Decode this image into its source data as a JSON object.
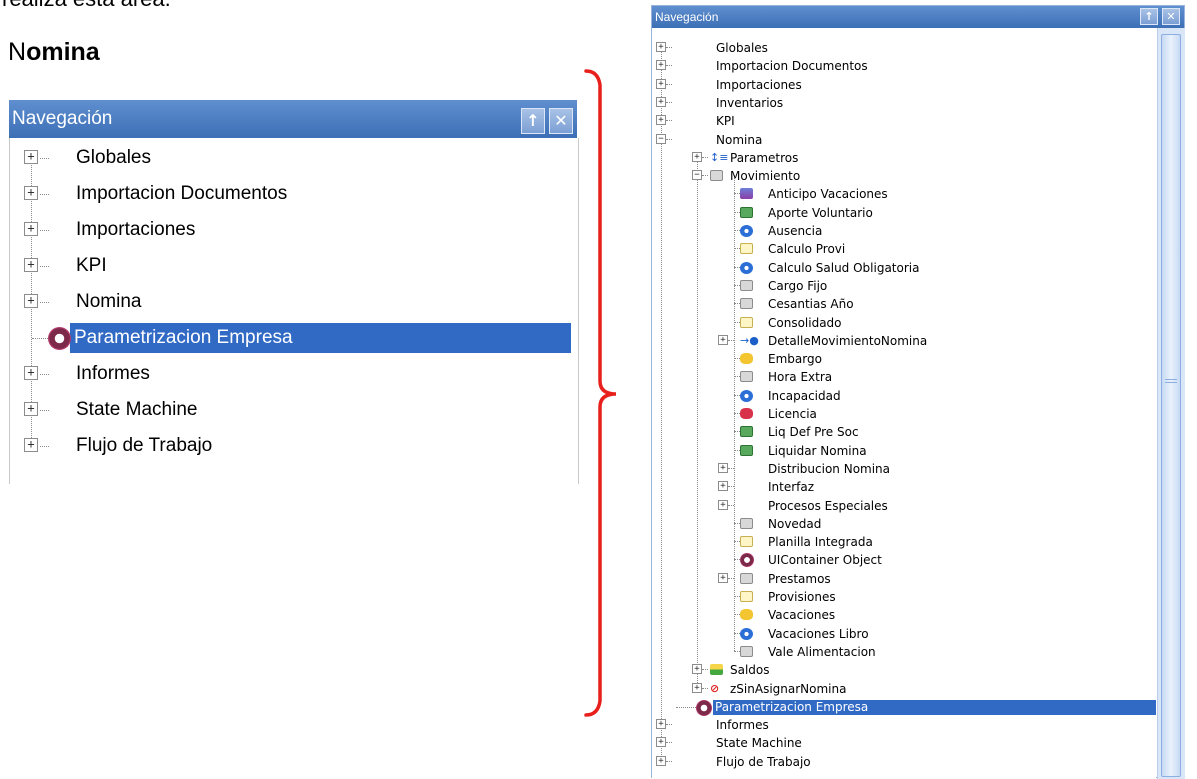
{
  "intro_text": "realiza esta área.",
  "section_title": {
    "prefix": "N",
    "rest": "omina"
  },
  "left_panel": {
    "title": "Navegación",
    "pin_glyph": "↑",
    "close_glyph": "✕",
    "items": [
      {
        "label": "Globales",
        "expandable": true
      },
      {
        "label": "Importacion Documentos",
        "expandable": true
      },
      {
        "label": "Importaciones",
        "expandable": true
      },
      {
        "label": "KPI",
        "expandable": true
      },
      {
        "label": "Nomina",
        "expandable": true
      },
      {
        "label": "Parametrizacion Empresa",
        "expandable": false,
        "selected": true,
        "icon": "gear-icon"
      },
      {
        "label": "Informes",
        "expandable": true
      },
      {
        "label": "State Machine",
        "expandable": true
      },
      {
        "label": "Flujo de Trabajo",
        "expandable": true
      }
    ]
  },
  "right_panel": {
    "title": "Navegación",
    "pin_glyph": "↑",
    "close_glyph": "✕",
    "items": [
      {
        "label": "Globales",
        "level": 0,
        "expander": "+"
      },
      {
        "label": "Importacion Documentos",
        "level": 0,
        "expander": "+"
      },
      {
        "label": "Importaciones",
        "level": 0,
        "expander": "+"
      },
      {
        "label": "Inventarios",
        "level": 0,
        "expander": "+"
      },
      {
        "label": "KPI",
        "level": 0,
        "expander": "+"
      },
      {
        "label": "Nomina",
        "level": 0,
        "expander": "-"
      },
      {
        "label": "Parametros",
        "level": 1,
        "expander": "+",
        "icon": "list-icon"
      },
      {
        "label": "Movimiento",
        "level": 1,
        "expander": "-",
        "icon": "gear-small-icon"
      },
      {
        "label": "Anticipo Vacaciones",
        "level": 2,
        "icon": "purple-form-icon"
      },
      {
        "label": "Aporte Voluntario",
        "level": 2,
        "icon": "money-icon"
      },
      {
        "label": "Ausencia",
        "level": 2,
        "icon": "blue-circle-icon"
      },
      {
        "label": "Calculo Provi",
        "level": 2,
        "icon": "document-icon"
      },
      {
        "label": "Calculo Salud Obligatoria",
        "level": 2,
        "icon": "blue-circle-icon"
      },
      {
        "label": "Cargo Fijo",
        "level": 2,
        "icon": "stamp-icon"
      },
      {
        "label": "Cesantias Año",
        "level": 2,
        "icon": "calculator-icon"
      },
      {
        "label": "Consolidado",
        "level": 2,
        "icon": "document-icon"
      },
      {
        "label": "DetalleMovimientoNomina",
        "level": 2,
        "expander": "+",
        "icon": "arrow-dot-icon"
      },
      {
        "label": "Embargo",
        "level": 2,
        "icon": "gavel-icon"
      },
      {
        "label": "Hora Extra",
        "level": 2,
        "icon": "clock-icon"
      },
      {
        "label": "Incapacidad",
        "level": 2,
        "icon": "blue-circle-icon"
      },
      {
        "label": "Licencia",
        "level": 2,
        "icon": "red-badge-icon"
      },
      {
        "label": "Liq Def Pre Soc",
        "level": 2,
        "icon": "money-icon"
      },
      {
        "label": "Liquidar Nomina",
        "level": 2,
        "icon": "money-icon"
      },
      {
        "label": "Distribucion Nomina",
        "level": 2,
        "expander": "+"
      },
      {
        "label": "Interfaz",
        "level": 2,
        "expander": "+"
      },
      {
        "label": "Procesos Especiales",
        "level": 2,
        "expander": "+"
      },
      {
        "label": "Novedad",
        "level": 2,
        "icon": "form-icon"
      },
      {
        "label": "Planilla Integrada",
        "level": 2,
        "icon": "sheet-icon"
      },
      {
        "label": "UIContainer Object",
        "level": 2,
        "icon": "gear-icon"
      },
      {
        "label": "Prestamos",
        "level": 2,
        "expander": "+",
        "icon": "bank-icon"
      },
      {
        "label": "Provisiones",
        "level": 2,
        "icon": "document-icon"
      },
      {
        "label": "Vacaciones",
        "level": 2,
        "icon": "gold-icon"
      },
      {
        "label": "Vacaciones Libro",
        "level": 2,
        "icon": "blue-circle-icon"
      },
      {
        "label": "Vale Alimentacion",
        "level": 2,
        "icon": "stamp-icon"
      },
      {
        "label": "Saldos",
        "level": 1,
        "expander": "+",
        "icon": "chart-icon"
      },
      {
        "label": "zSinAsignarNomina",
        "level": 1,
        "expander": "+",
        "icon": "block-icon"
      },
      {
        "label": "Parametrizacion Empresa",
        "level": 0,
        "selected": true,
        "icon": "gear-icon"
      },
      {
        "label": "Informes",
        "level": 0,
        "expander": "+"
      },
      {
        "label": "State Machine",
        "level": 0,
        "expander": "+"
      },
      {
        "label": "Flujo de Trabajo",
        "level": 0,
        "expander": "+"
      }
    ]
  },
  "colors": {
    "titlebar": "#4a7cc2",
    "selection": "#316ac5",
    "bracket": "#e8201c"
  }
}
